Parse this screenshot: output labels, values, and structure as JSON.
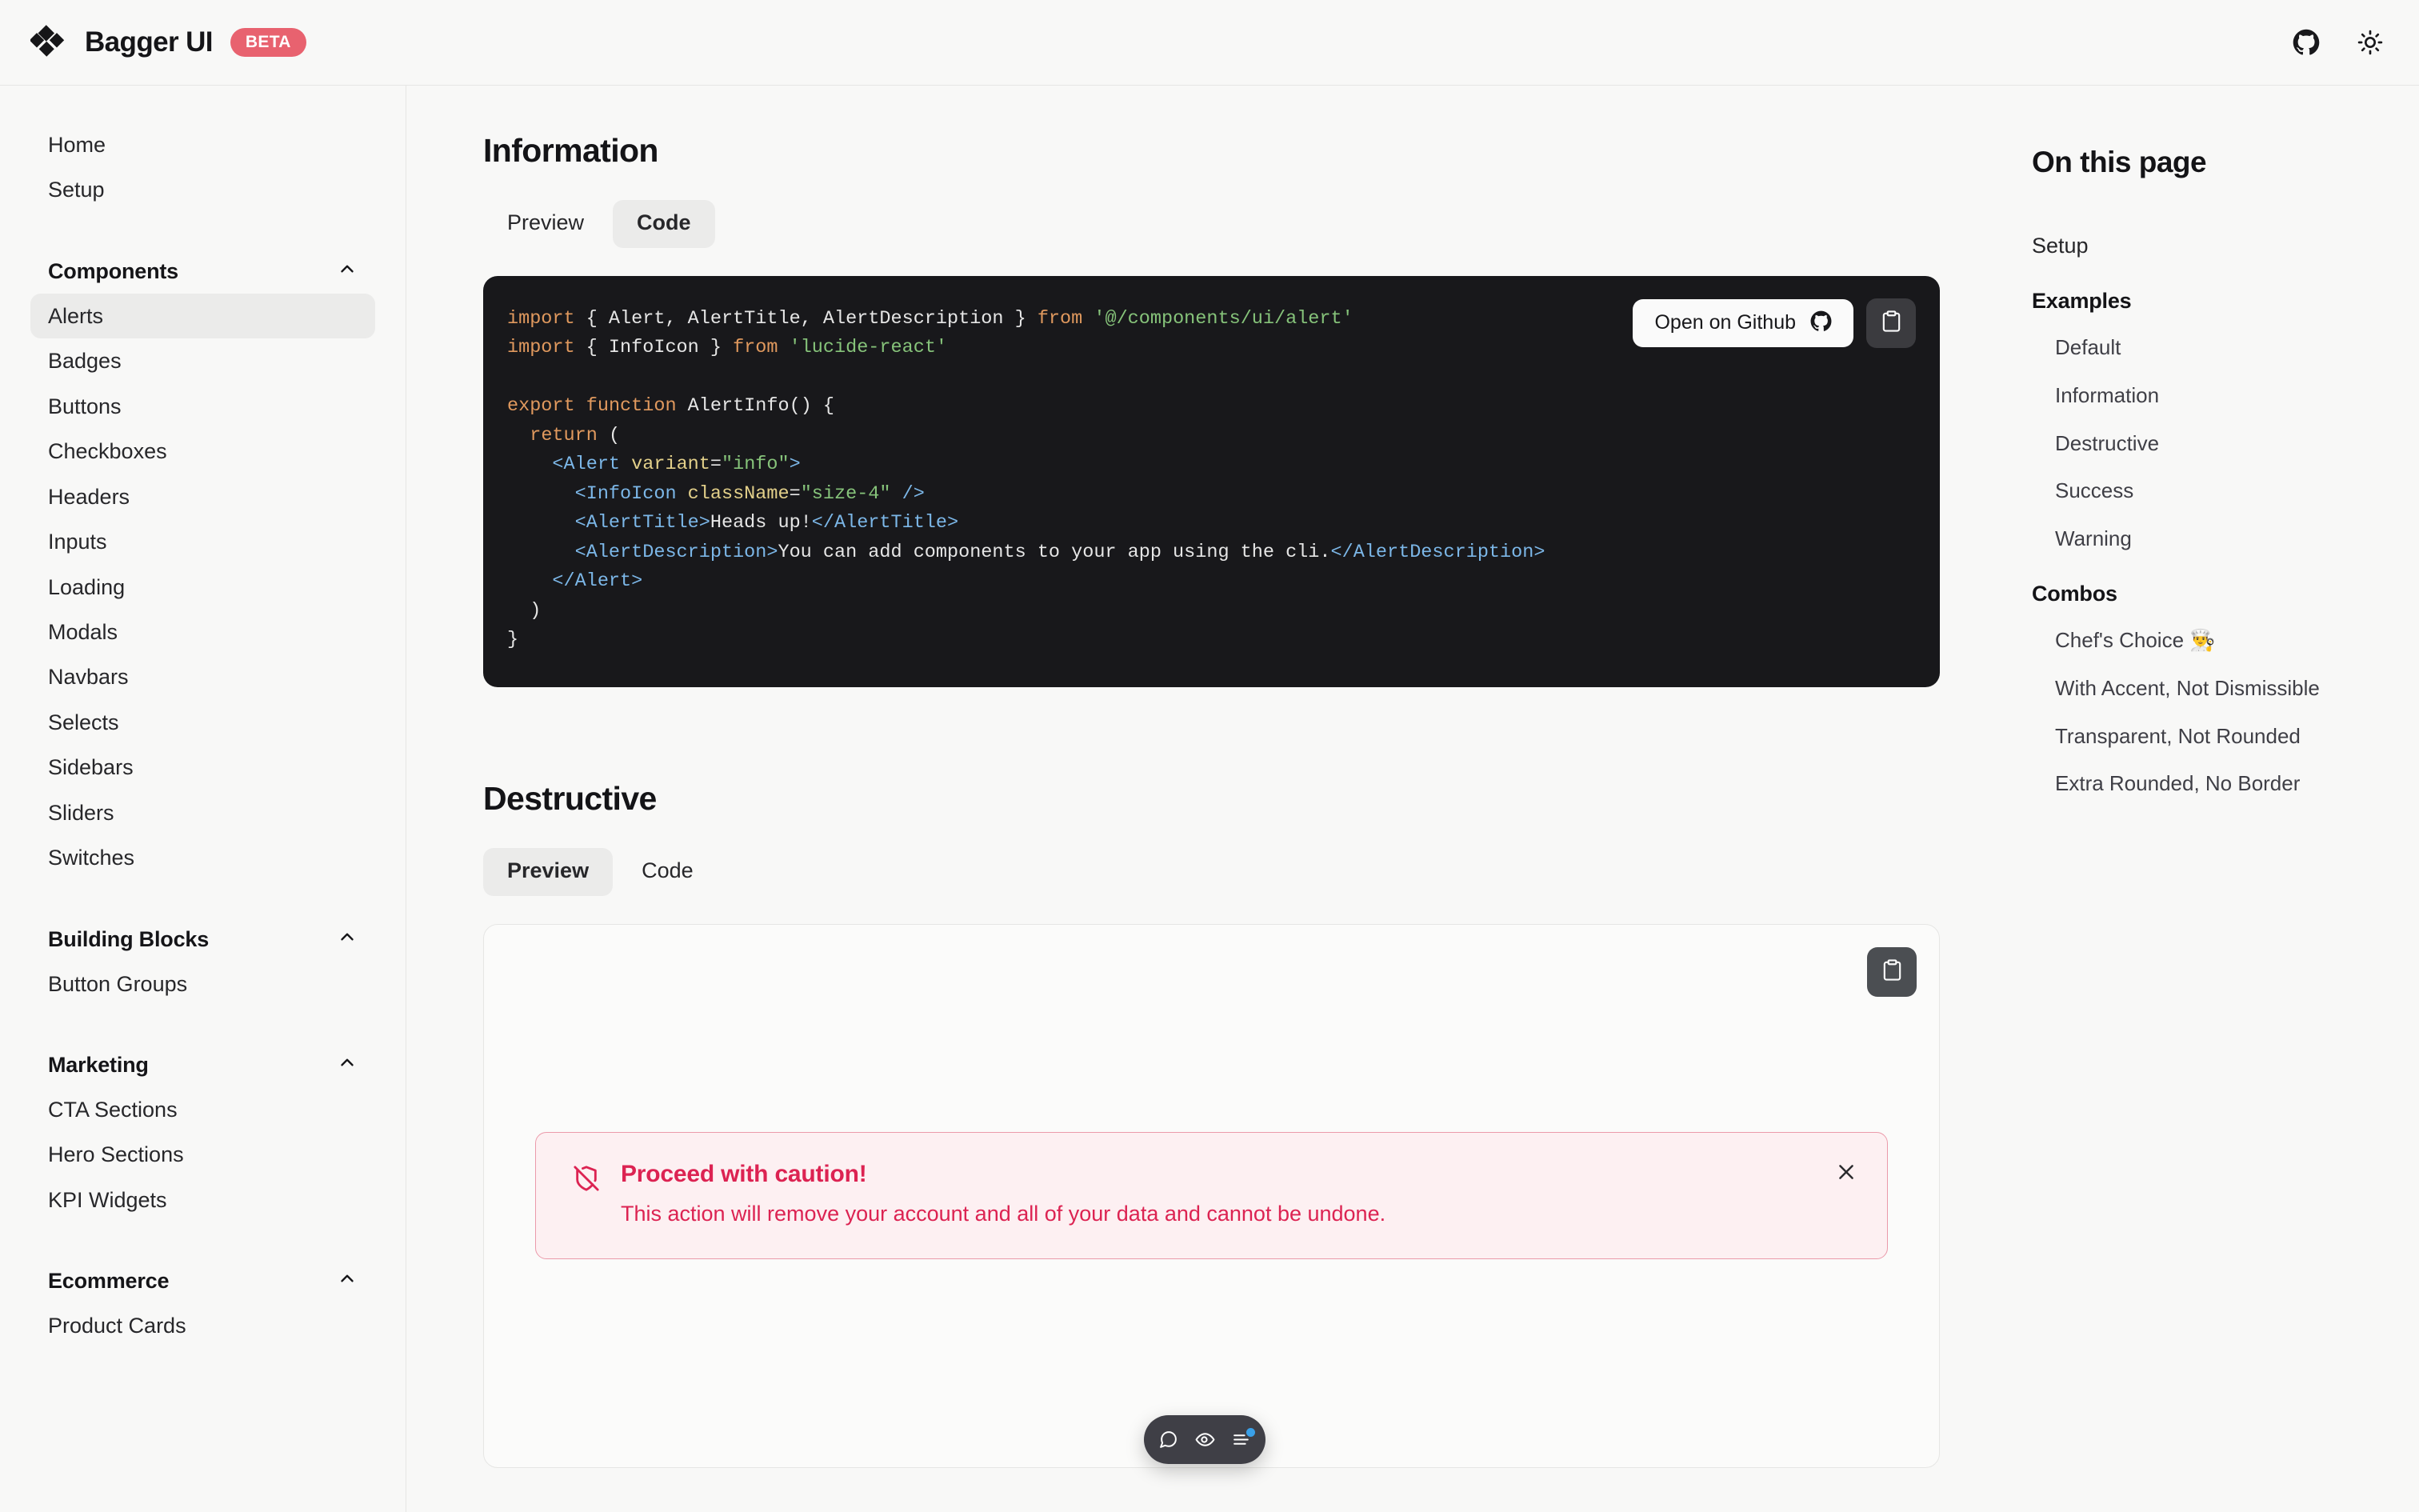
{
  "header": {
    "brand_name": "Bagger UI",
    "beta_label": "BETA",
    "logo_icon": "diamond-cluster-logo",
    "github_icon": "github-icon",
    "theme_icon": "sun-icon"
  },
  "sidebar": {
    "top_links": [
      {
        "label": "Home",
        "name": "sidebar-item-home"
      },
      {
        "label": "Setup",
        "name": "sidebar-item-setup"
      }
    ],
    "sections": [
      {
        "title": "Components",
        "name": "sidebar-section-components",
        "chevron_icon": "chevron-up-icon",
        "items": [
          {
            "label": "Alerts",
            "active": true
          },
          {
            "label": "Badges",
            "active": false
          },
          {
            "label": "Buttons",
            "active": false
          },
          {
            "label": "Checkboxes",
            "active": false
          },
          {
            "label": "Headers",
            "active": false
          },
          {
            "label": "Inputs",
            "active": false
          },
          {
            "label": "Loading",
            "active": false
          },
          {
            "label": "Modals",
            "active": false
          },
          {
            "label": "Navbars",
            "active": false
          },
          {
            "label": "Selects",
            "active": false
          },
          {
            "label": "Sidebars",
            "active": false
          },
          {
            "label": "Sliders",
            "active": false
          },
          {
            "label": "Switches",
            "active": false
          }
        ]
      },
      {
        "title": "Building Blocks",
        "name": "sidebar-section-building-blocks",
        "chevron_icon": "chevron-up-icon",
        "items": [
          {
            "label": "Button Groups",
            "active": false
          }
        ]
      },
      {
        "title": "Marketing",
        "name": "sidebar-section-marketing",
        "chevron_icon": "chevron-up-icon",
        "items": [
          {
            "label": "CTA Sections",
            "active": false
          },
          {
            "label": "Hero Sections",
            "active": false
          },
          {
            "label": "KPI Widgets",
            "active": false
          }
        ]
      },
      {
        "title": "Ecommerce",
        "name": "sidebar-section-ecommerce",
        "chevron_icon": "chevron-up-icon",
        "items": [
          {
            "label": "Product Cards",
            "active": false
          }
        ]
      }
    ]
  },
  "main": {
    "information": {
      "heading": "Information",
      "tabs": [
        {
          "label": "Preview",
          "active": false
        },
        {
          "label": "Code",
          "active": true
        }
      ],
      "github_button_label": "Open on Github",
      "github_button_icon": "github-icon",
      "copy_button_icon": "clipboard-icon",
      "code_lines": [
        [
          {
            "t": "import",
            "c": "kw"
          },
          {
            "t": " { Alert, AlertTitle, AlertDescription } ",
            "c": "txt"
          },
          {
            "t": "from",
            "c": "kw"
          },
          {
            "t": " ",
            "c": "txt"
          },
          {
            "t": "'@/components/ui/alert'",
            "c": "str"
          }
        ],
        [
          {
            "t": "import",
            "c": "kw"
          },
          {
            "t": " { InfoIcon } ",
            "c": "txt"
          },
          {
            "t": "from",
            "c": "kw"
          },
          {
            "t": " ",
            "c": "txt"
          },
          {
            "t": "'lucide-react'",
            "c": "str"
          }
        ],
        [],
        [
          {
            "t": "export",
            "c": "kw"
          },
          {
            "t": " ",
            "c": "txt"
          },
          {
            "t": "function",
            "c": "kw"
          },
          {
            "t": " AlertInfo() {",
            "c": "txt"
          }
        ],
        [
          {
            "t": "  ",
            "c": "txt"
          },
          {
            "t": "return",
            "c": "kw"
          },
          {
            "t": " (",
            "c": "txt"
          }
        ],
        [
          {
            "t": "    ",
            "c": "txt"
          },
          {
            "t": "<Alert",
            "c": "tag"
          },
          {
            "t": " ",
            "c": "txt"
          },
          {
            "t": "variant",
            "c": "attr"
          },
          {
            "t": "=",
            "c": "txt"
          },
          {
            "t": "\"info\"",
            "c": "str"
          },
          {
            "t": ">",
            "c": "tag"
          }
        ],
        [
          {
            "t": "      ",
            "c": "txt"
          },
          {
            "t": "<InfoIcon",
            "c": "tag"
          },
          {
            "t": " ",
            "c": "txt"
          },
          {
            "t": "className",
            "c": "attr"
          },
          {
            "t": "=",
            "c": "txt"
          },
          {
            "t": "\"size-4\"",
            "c": "str"
          },
          {
            "t": " ",
            "c": "txt"
          },
          {
            "t": "/>",
            "c": "tag"
          }
        ],
        [
          {
            "t": "      ",
            "c": "txt"
          },
          {
            "t": "<AlertTitle>",
            "c": "tag"
          },
          {
            "t": "Heads up!",
            "c": "txt"
          },
          {
            "t": "</AlertTitle>",
            "c": "tag"
          }
        ],
        [
          {
            "t": "      ",
            "c": "txt"
          },
          {
            "t": "<AlertDescription>",
            "c": "tag"
          },
          {
            "t": "You can add components to your app using the cli.",
            "c": "txt"
          },
          {
            "t": "</AlertDescription>",
            "c": "tag"
          }
        ],
        [
          {
            "t": "    ",
            "c": "txt"
          },
          {
            "t": "</Alert>",
            "c": "tag"
          }
        ],
        [
          {
            "t": "  )",
            "c": "txt"
          }
        ],
        [
          {
            "t": "}",
            "c": "txt"
          }
        ]
      ]
    },
    "destructive": {
      "heading": "Destructive",
      "tabs": [
        {
          "label": "Preview",
          "active": true
        },
        {
          "label": "Code",
          "active": false
        }
      ],
      "copy_button_icon": "clipboard-icon",
      "alert": {
        "icon": "shield-off-icon",
        "title": "Proceed with caution!",
        "description": "This action will remove your account and all of your data and cannot be undone.",
        "close_icon": "close-icon",
        "bg_color": "#fdf0f2",
        "border_color": "#eb9aaa",
        "text_color": "#dc2352"
      }
    }
  },
  "rail": {
    "title": "On this page",
    "setup_link": "Setup",
    "groups": [
      {
        "title": "Examples",
        "items": [
          "Default",
          "Information",
          "Destructive",
          "Success",
          "Warning"
        ]
      },
      {
        "title": "Combos",
        "items": [
          "Chef's Choice 👨‍🍳",
          "With Accent, Not Dismissible",
          "Transparent, Not Rounded",
          "Extra Rounded, No Border"
        ]
      }
    ]
  },
  "float_toolbar": {
    "items": [
      {
        "icon": "comment-icon",
        "badge": false
      },
      {
        "icon": "eye-icon",
        "badge": false
      },
      {
        "icon": "list-settings-icon",
        "badge": true
      }
    ],
    "badge_color": "#3aa0e8"
  },
  "colors": {
    "page_bg": "#f8f8f7",
    "border": "#e6e6e4",
    "code_bg": "#18181b",
    "accent_beta": "#e8626f",
    "destructive": "#dc2352"
  }
}
